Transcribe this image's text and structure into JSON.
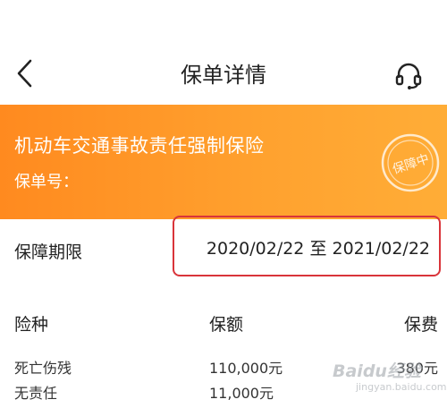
{
  "header": {
    "title": "保单详情",
    "back_icon": "chevron-left-icon",
    "service_icon": "headset-icon"
  },
  "banner": {
    "title": "机动车交通事故责任强制保险",
    "policy_label": "保单号：",
    "stamp_text": "保障中",
    "colors": {
      "start": "#ff8a1f",
      "end": "#ffad37"
    }
  },
  "period": {
    "label": "保障期限",
    "value": "2020/02/22 至 2021/02/22",
    "highlight_color": "#d9343a"
  },
  "coverage": {
    "columns": [
      "险种",
      "保额",
      "保费"
    ],
    "rows": [
      [
        "死亡伤残",
        "110,000元",
        "380元"
      ],
      [
        "无责任",
        "11,000元",
        ""
      ]
    ]
  },
  "watermark": {
    "text": "Baidu经验",
    "sub": "jingyan.baidu.com"
  }
}
